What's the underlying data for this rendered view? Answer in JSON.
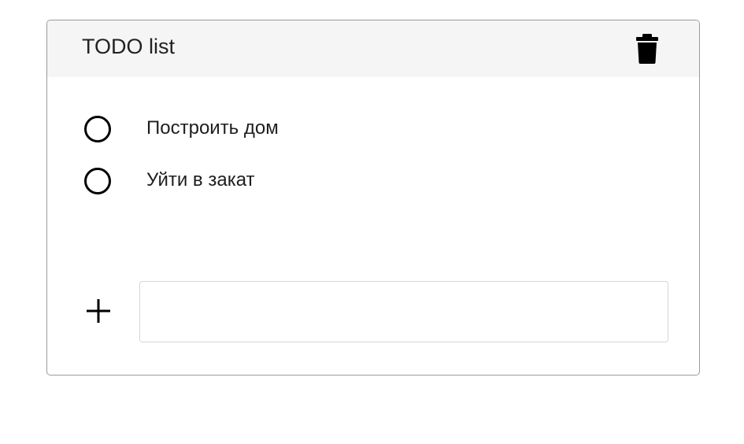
{
  "header": {
    "title": "TODO list",
    "delete_icon": "trash-icon"
  },
  "items": [
    {
      "label": "Построить дом",
      "checked": false,
      "icon": "circle-outline-icon"
    },
    {
      "label": "Уйти в закат",
      "checked": false,
      "icon": "circle-outline-icon"
    }
  ],
  "new_item": {
    "add_icon": "plus-icon",
    "value": "",
    "placeholder": ""
  },
  "colors": {
    "header_background": "#f5f5f5",
    "border": "#9a9a9a",
    "text": "#1e1e1e",
    "icon": "#000000"
  }
}
